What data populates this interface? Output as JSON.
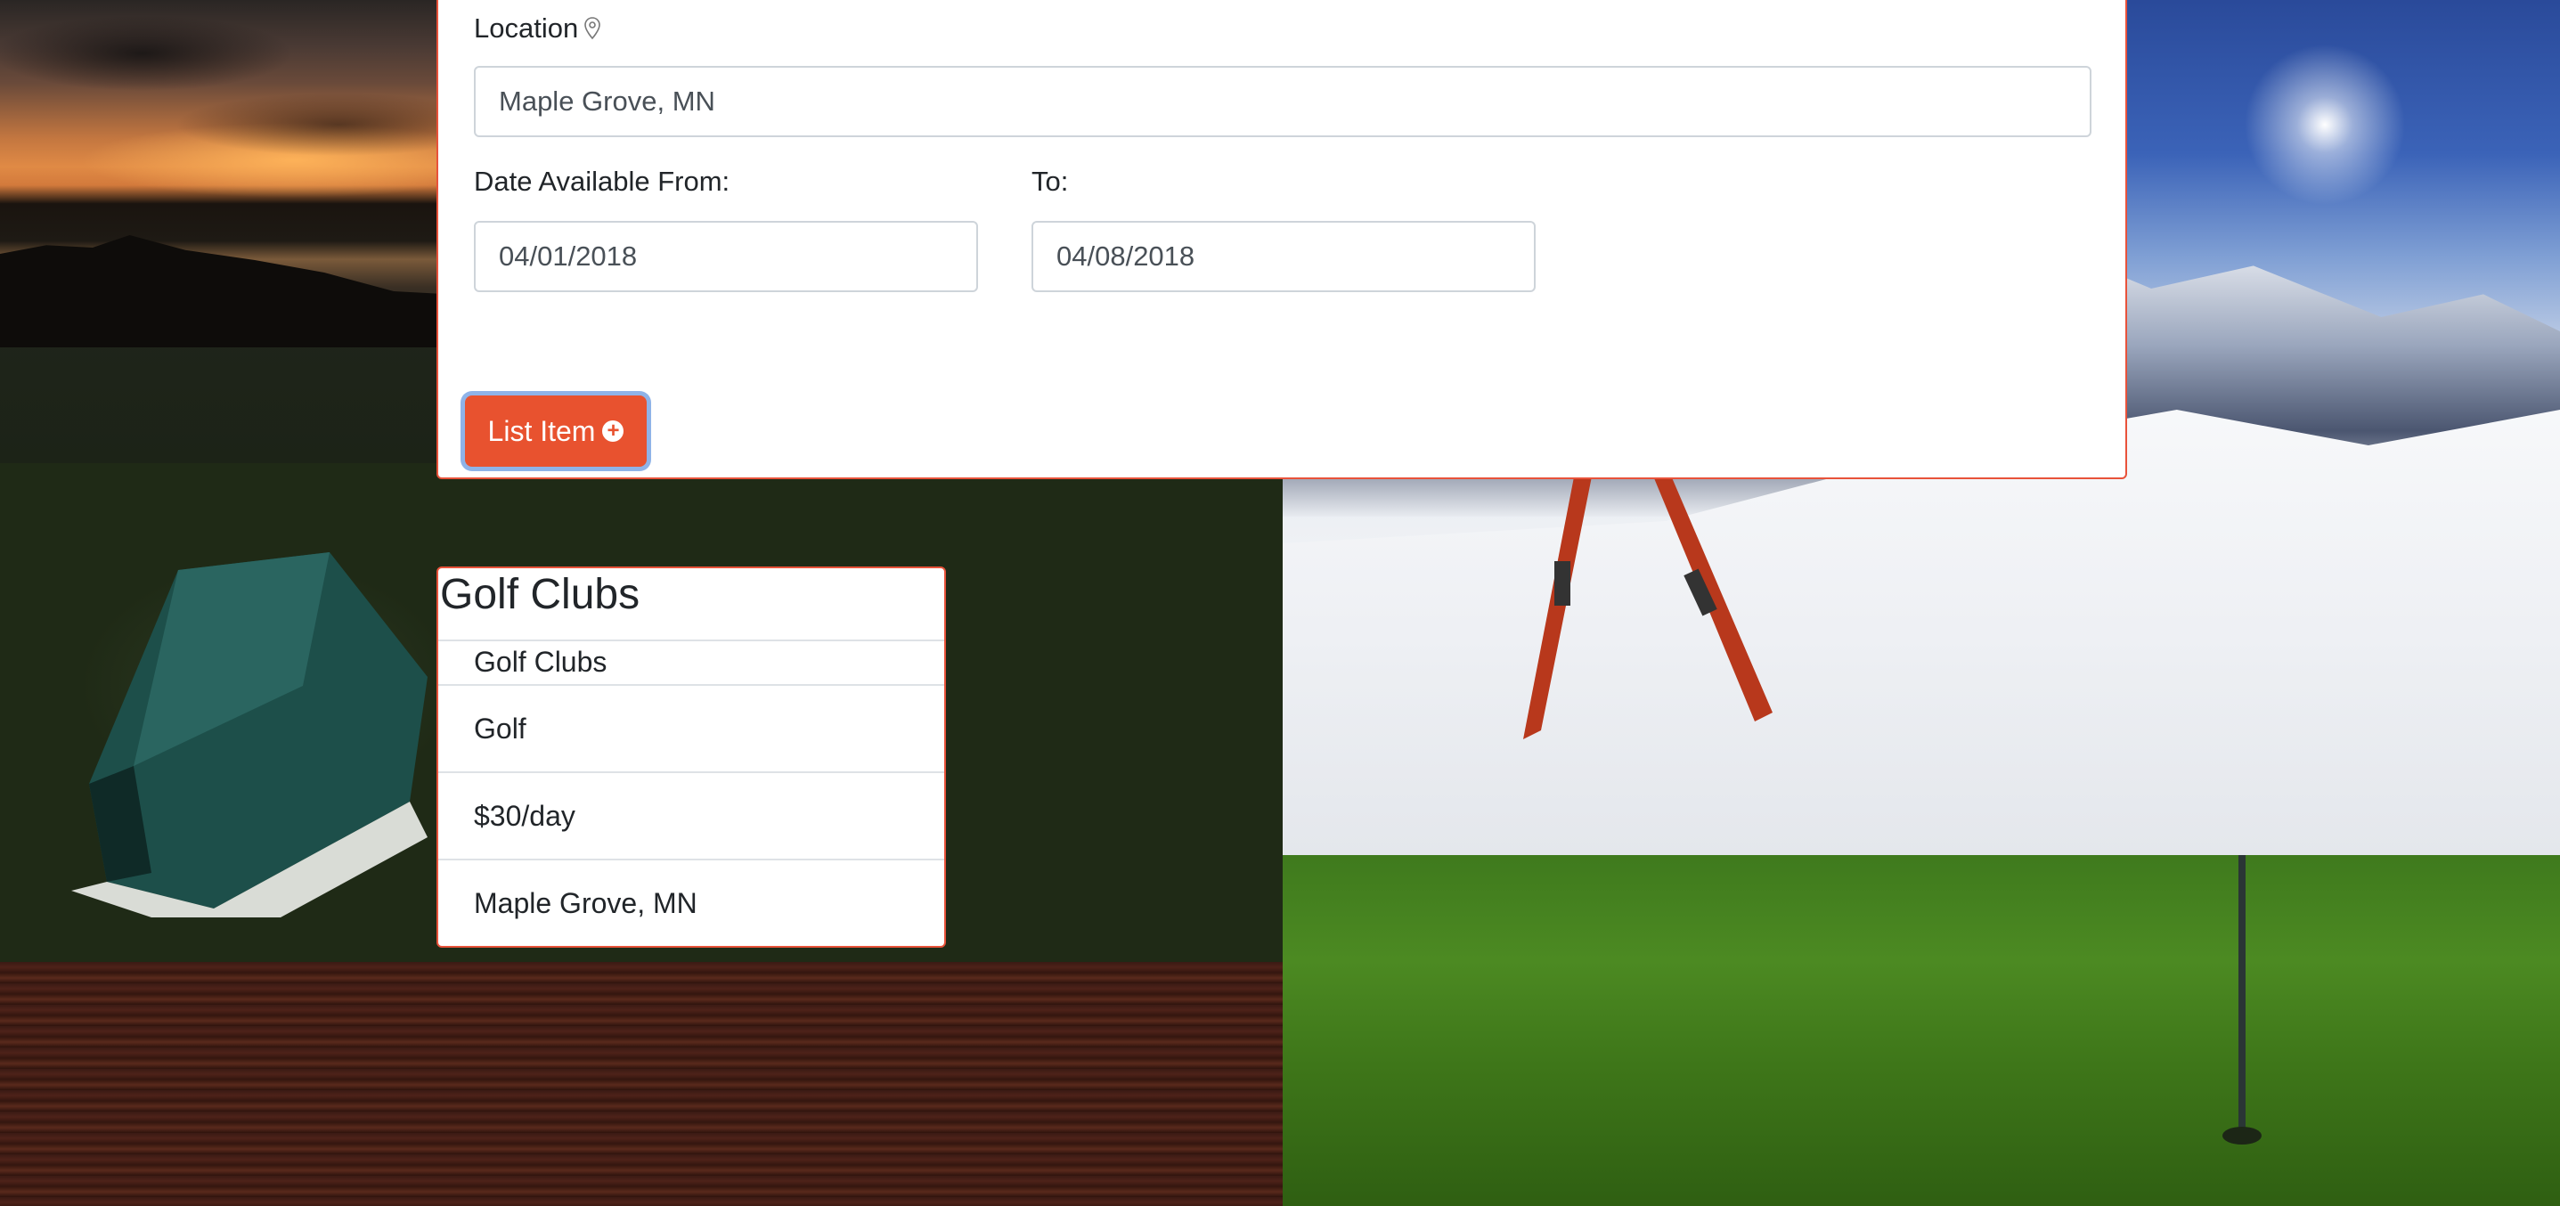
{
  "form": {
    "location_label": "Location",
    "location_icon": "map-pin-icon",
    "location_value": "Maple Grove, MN",
    "date_from_label": "Date Available From:",
    "date_from_value": "04/01/2018",
    "date_to_label": "To:",
    "date_to_value": "04/08/2018",
    "submit_label": "List Item",
    "submit_icon": "plus-circle-icon",
    "accent_color": "#e8522f"
  },
  "item_card": {
    "title": "Golf Clubs",
    "name": "Golf Clubs",
    "category": "Golf",
    "price": "$30/day",
    "location": "Maple Grove, MN",
    "border_color": "#e8523a"
  }
}
